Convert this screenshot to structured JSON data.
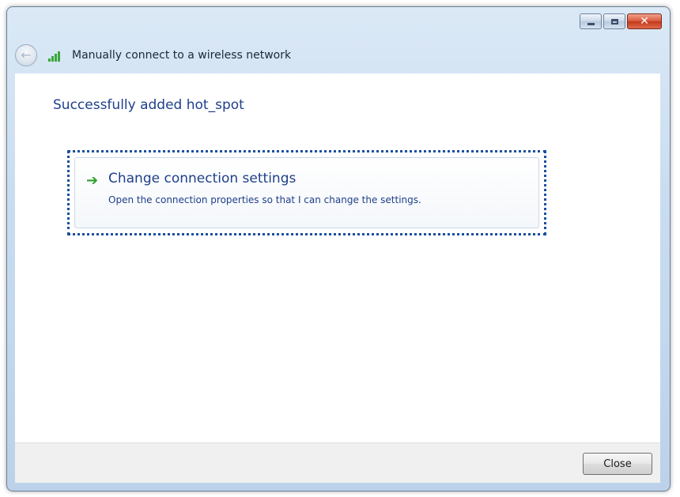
{
  "window": {
    "title": "Manually connect to a wireless network",
    "controls": {
      "minimize_icon": "minimize-icon",
      "maximize_icon": "maximize-icon",
      "close_icon": "close-icon",
      "close_glyph": "✕"
    },
    "back_icon": "back-arrow-icon",
    "network_icon": "wireless-signal-icon"
  },
  "main": {
    "heading": "Successfully added hot_spot",
    "command_link": {
      "arrow_icon": "green-arrow-icon",
      "title": "Change connection settings",
      "description": "Open the connection properties so that I can change the settings."
    }
  },
  "footer": {
    "close_label": "Close"
  },
  "colors": {
    "accent_text": "#1e3f8a",
    "arrow_green": "#2e9e2e",
    "focus_border": "#1c4f9e"
  }
}
